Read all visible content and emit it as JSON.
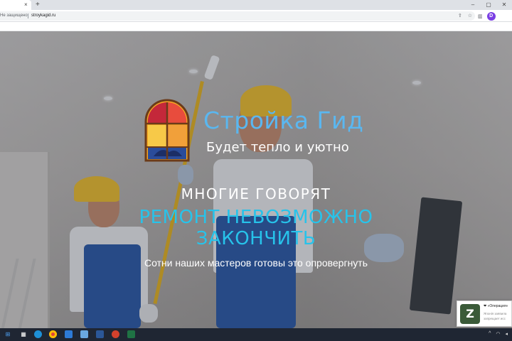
{
  "browser": {
    "tab_close": "×",
    "new_tab": "+",
    "security_label": "Не защищено",
    "url": "stroykagid.ru",
    "profile_initial": "D"
  },
  "hero": {
    "brand_name": "Стройка Гид",
    "tagline": "Будет тепло и уютно",
    "heading": "МНОГИЕ ГОВОРЯТ",
    "accent_line1": "РЕМОНТ НЕВОЗМОЖНО",
    "accent_line2": "ЗАКОНЧИТЬ",
    "subheading": "Сотни наших мастеров готовы это опровергнуть"
  },
  "notification": {
    "icon_letter": "Z",
    "title": "❤ «Операция»",
    "line1": "Японія заявила",
    "line2": "запрещает исс"
  },
  "colors": {
    "brand_blue": "#5ab7f0",
    "accent_cyan": "#27c3ea",
    "taskbar": "#1f2633"
  }
}
